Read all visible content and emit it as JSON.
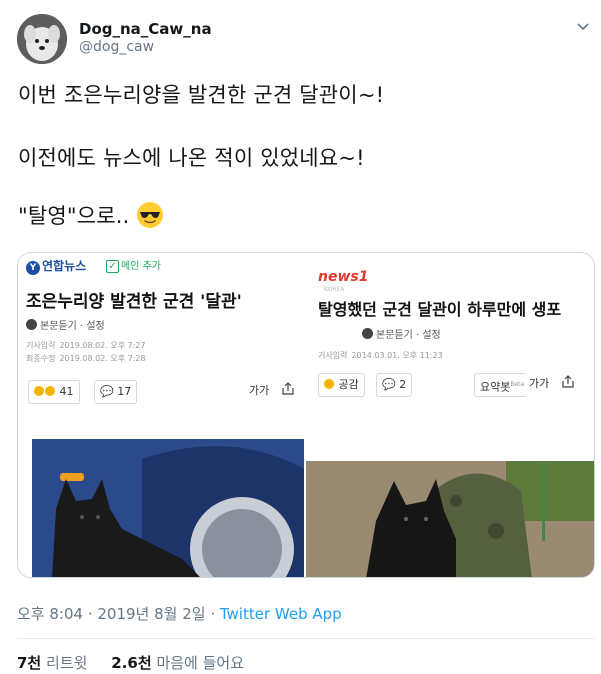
{
  "user": {
    "name": "Dog_na_Caw_na",
    "handle": "@dog_caw"
  },
  "tweet": {
    "line1": "이번 조은누리양을 발견한 군견 달관이~!",
    "line2": "이전에도 뉴스에 나온 적이 있었네요~!",
    "line3": "\"탈영\"으로.."
  },
  "card_left": {
    "source": "연합뉴스",
    "main_add": "메인 추가",
    "headline": "조은누리양 발견한 군견 '달관'",
    "listen": "본문듣기 · 설정",
    "meta_label1": "기사입력",
    "meta_value1": "2019.08.02. 오후 7:27",
    "meta_label2": "최종수정",
    "meta_value2": "2019.08.02. 오후 7:28",
    "reactions": "41",
    "comments": "17",
    "font_btn": "가가"
  },
  "card_right": {
    "source": "news1",
    "source_sub": "KOREA",
    "headline": "탈영했던 군견 달관이 하루만에 생포",
    "listen": "본문듣기 · 설정",
    "meta_label": "기사입력",
    "meta_value": "2014.03.01. 오후 11:23",
    "like_label": "공감",
    "comments": "2",
    "summary_btn": "요약봇",
    "summary_beta": "Beta",
    "font_btn": "가가"
  },
  "footer": {
    "time": "오후 8:04 · 2019년 8월 2일 · ",
    "app": "Twitter Web App",
    "retweets_count": "7천",
    "retweets_label": "리트윗",
    "likes_count": "2.6천",
    "likes_label": "마음에 들어요"
  },
  "colors": {
    "link": "#1da1f2",
    "secondary": "#657786",
    "text": "#14171a"
  }
}
